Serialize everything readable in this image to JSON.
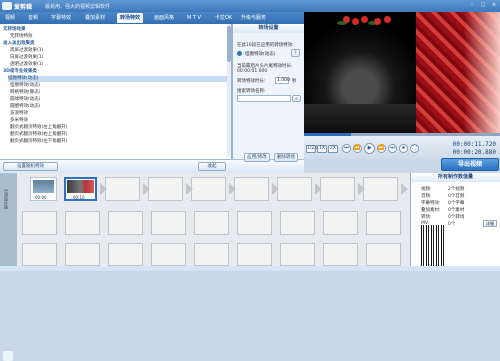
{
  "app": {
    "title": "爱剪辑",
    "subtitle": "最易用、强大的视频剪辑软件"
  },
  "window_controls": [
    "–",
    "□",
    "×"
  ],
  "tabs": [
    {
      "label": "视频",
      "active": false
    },
    {
      "label": "音频",
      "active": false
    },
    {
      "label": "字幕特效",
      "active": false
    },
    {
      "label": "叠加素材",
      "active": false
    },
    {
      "label": "转场特效",
      "active": true
    },
    {
      "label": "画面风格",
      "active": false
    },
    {
      "label": "M T V",
      "active": false
    },
    {
      "label": "卡拉OK",
      "active": false
    },
    {
      "label": "升级与服务",
      "active": false
    }
  ],
  "left_tree": [
    {
      "label": "无转场效果",
      "type": "cat"
    },
    {
      "label": "无转场特效",
      "type": "item"
    },
    {
      "label": "淡入淡出效果类",
      "type": "cat"
    },
    {
      "label": "黑屏过渡效果(1)",
      "type": "item"
    },
    {
      "label": "白屏过渡效果(1)",
      "type": "item"
    },
    {
      "label": "透明过渡效果(1)",
      "type": "item"
    },
    {
      "label": "3D或专业效果类",
      "type": "cat"
    },
    {
      "label": "怪圈特效(动态)",
      "type": "selected"
    },
    {
      "label": "怪圈特效(动态)",
      "type": "item"
    },
    {
      "label": "网格特效(静态)",
      "type": "item"
    },
    {
      "label": "圆球特效(动态)",
      "type": "item"
    },
    {
      "label": "圆圈特效(动态)",
      "type": "item"
    },
    {
      "label": "波浪特效",
      "type": "item"
    },
    {
      "label": "多米特效",
      "type": "item"
    },
    {
      "label": "翻页式翻页特效(左上角翻开)",
      "type": "item"
    },
    {
      "label": "翻页式翻页特效(右上角翻开)",
      "type": "item"
    },
    {
      "label": "翻页式翻页特效(左下角翻开)",
      "type": "item"
    }
  ],
  "bottom_buttons": {
    "favorites": "设置随机特效",
    "collapse": "收起"
  },
  "settings": {
    "header": "转场设置",
    "current_effect_label": "在此16段已应用的转场特效:",
    "current_effect_value": "怪圈特效(动态)",
    "duration_label": "当前最后片头片尾特效时长:",
    "duration_value": "00:00:01.000",
    "frame_label": "转场特效时长:",
    "frame_value": "1.000",
    "frame_unit": "秒",
    "search_label": "搜索转场名称:",
    "search_value": "",
    "apply_button": "应用/修改",
    "remove_button": "删除转场"
  },
  "player": {
    "current_time": "00:00:11.720",
    "total_time": "00:00:20.880",
    "progress_percent": 24,
    "buttons": [
      "1/2X",
      "1X",
      "2X",
      "⏮",
      "⏪",
      "▶",
      "⏩",
      "⏭",
      "⏹",
      "⛶"
    ],
    "export_button": "导出视频"
  },
  "timeline": {
    "header": "已添加片段",
    "clips": [
      {
        "label": "00:06"
      },
      {
        "label": "00:10"
      }
    ]
  },
  "project_panel": {
    "header": "所有制作数值量",
    "rows": [
      {
        "label": "视频:",
        "value": "2个视频"
      },
      {
        "label": "音频:",
        "value": "0个音频"
      },
      {
        "label": "字幕特效:",
        "value": "0个字幕"
      },
      {
        "label": "叠加素材:",
        "value": "0个素材"
      },
      {
        "label": "转场:",
        "value": "0个转场"
      },
      {
        "label": "MV:",
        "value": "0个"
      }
    ],
    "edit_button": "详细"
  },
  "icons": [
    "logo-icon",
    "play-icon",
    "pause-icon",
    "stop-icon",
    "fullscreen-icon",
    "export-icon",
    "timeline-icon"
  ],
  "colors": {
    "accent": "#2b6bb0",
    "selection": "#c7ddf6",
    "export_button": "#2b70c0"
  }
}
